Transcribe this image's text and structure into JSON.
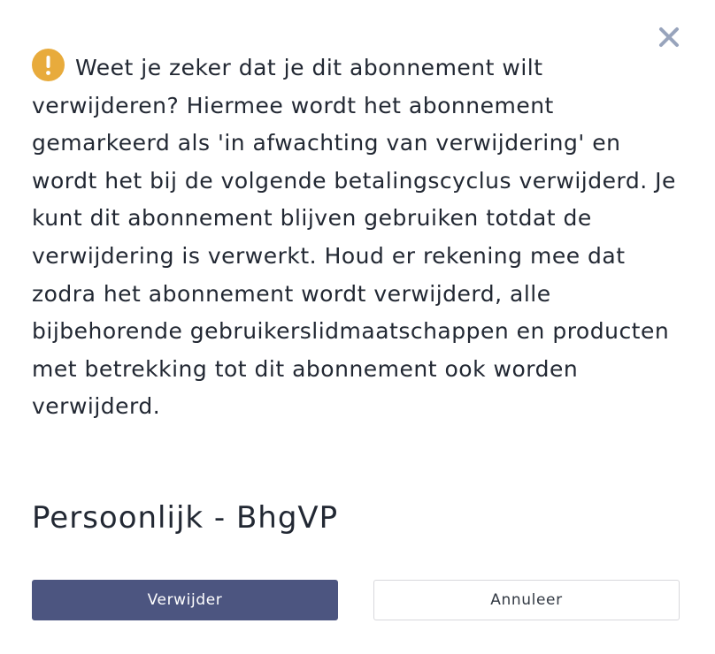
{
  "dialog": {
    "close_icon": "close-icon",
    "warning_icon": "exclamation-circle-icon",
    "message": "Weet je zeker dat je dit abonnement wilt verwijderen? Hiermee wordt het abonnement gemarkeerd als 'in afwachting van verwijdering' en wordt het bij de volgende betalingscyclus verwijderd. Je kunt dit abonnement blijven gebruiken totdat de verwijdering is verwerkt. Houd er rekening mee dat zodra het abonnement wordt verwijderd, alle bijbehorende gebruikerslidmaatschappen en producten met betrekking tot dit abonnement ook worden verwijderd.",
    "subscription_name": "Persoonlijk - BhgVP",
    "confirm_label": "Verwijder",
    "cancel_label": "Annuleer"
  },
  "colors": {
    "warning": "#e8ab3c",
    "primary_button": "#4c5580",
    "close_icon": "#98a4bc",
    "text": "#222833"
  }
}
